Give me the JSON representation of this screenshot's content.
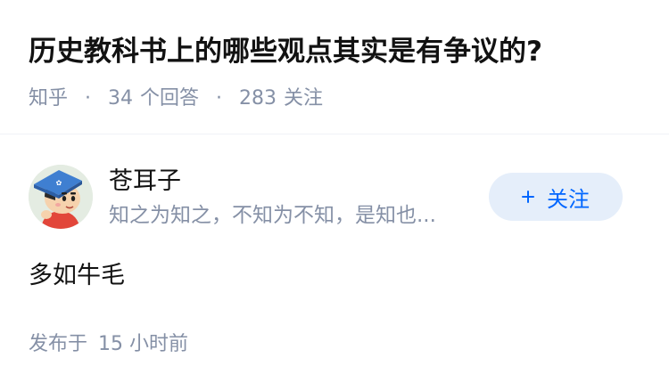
{
  "question": {
    "title": "历史教科书上的哪些观点其实是有争议的?",
    "source": "知乎",
    "separator": "·",
    "answer_count": "34",
    "answer_label": "个回答",
    "follower_count": "283",
    "follower_label": "关注"
  },
  "answer": {
    "author": {
      "name": "苍耳子",
      "bio": "知之为知之，不知为不知，是知也...",
      "avatar_icon": "cartoon-avatar-icon"
    },
    "follow_button": {
      "icon": "plus-icon",
      "label": "关注"
    },
    "content": "多如牛毛",
    "published_label": "发布于",
    "published_time": "15 小时前"
  },
  "colors": {
    "title": "#121212",
    "meta": "#8590a6",
    "accent": "#0066ff",
    "button_bg": "#e5eefa",
    "divider": "#f0f2f7"
  }
}
